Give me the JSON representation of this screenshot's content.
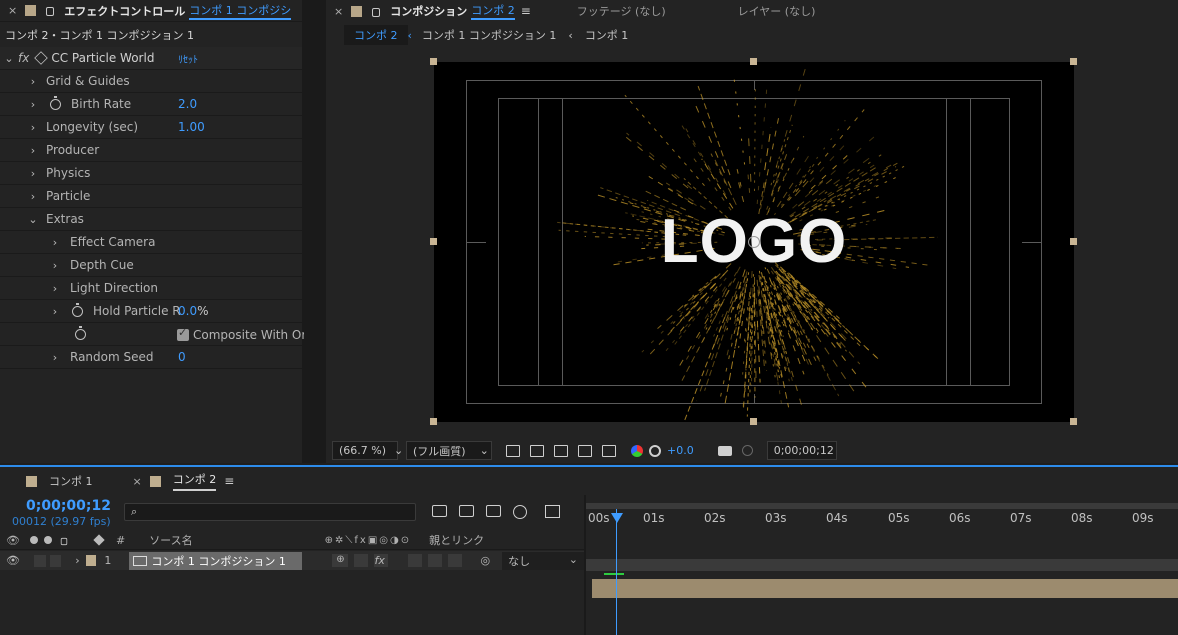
{
  "effect_controls": {
    "tab_close": "×",
    "tab_title": "エフェクトコントロール",
    "tab_target": "コンポ 1 コンポジシ",
    "panel_menu": "≫",
    "breadcrumb": "コンポ 2・コンポ 1 コンポジション 1",
    "effect_name": "CC Particle World",
    "reset_label": "ﾘｾｯﾄ",
    "fx_label": "fx",
    "properties": [
      {
        "label": "Grid & Guides",
        "value": ""
      },
      {
        "label": "Birth Rate",
        "value": "2.0"
      },
      {
        "label": "Longevity (sec)",
        "value": "1.00"
      },
      {
        "label": "Producer",
        "value": ""
      },
      {
        "label": "Physics",
        "value": ""
      },
      {
        "label": "Particle",
        "value": ""
      },
      {
        "label": "Extras",
        "value": ""
      },
      {
        "label": "Effect Camera",
        "value": ""
      },
      {
        "label": "Depth Cue",
        "value": ""
      },
      {
        "label": "Light Direction",
        "value": ""
      },
      {
        "label": "Hold Particle R",
        "value": "0.0",
        "unit": "%"
      },
      {
        "label": "Composite With Ori",
        "value": ""
      },
      {
        "label": "Random Seed",
        "value": "0"
      }
    ]
  },
  "composition": {
    "tab_close": "×",
    "tab_title": "コンポジション",
    "tab_target": "コンポ 2",
    "tab_menu": "≡",
    "footage_tab": "フッテージ (なし)",
    "layer_tab": "レイヤー (なし)",
    "nav": [
      "コンポ 2",
      "コンポ 1 コンポジション 1",
      "コンポ 1"
    ],
    "logo_text": "LOGO",
    "zoom": "(66.7 %)",
    "resolution": "(フル画質)",
    "exposure": "+0.0",
    "timecode": "0;00;00;12"
  },
  "timeline": {
    "tabs": [
      {
        "label": "コンポ 1",
        "active": false
      },
      {
        "label": "コンポ 2",
        "active": true
      }
    ],
    "tab_close": "×",
    "tab_menu": "≡",
    "current_time": "0;00;00;12",
    "frame_info": "00012 (29.97 fps)",
    "search_placeholder": "",
    "col_num": "#",
    "col_source": "ソース名",
    "col_parent": "親とリンク",
    "layer": {
      "index": "1",
      "name": "コンポ 1 コンポジション 1",
      "parent": "なし"
    },
    "ruler": [
      "00s",
      "01s",
      "02s",
      "03s",
      "04s",
      "05s",
      "06s",
      "07s",
      "08s",
      "09s"
    ]
  }
}
